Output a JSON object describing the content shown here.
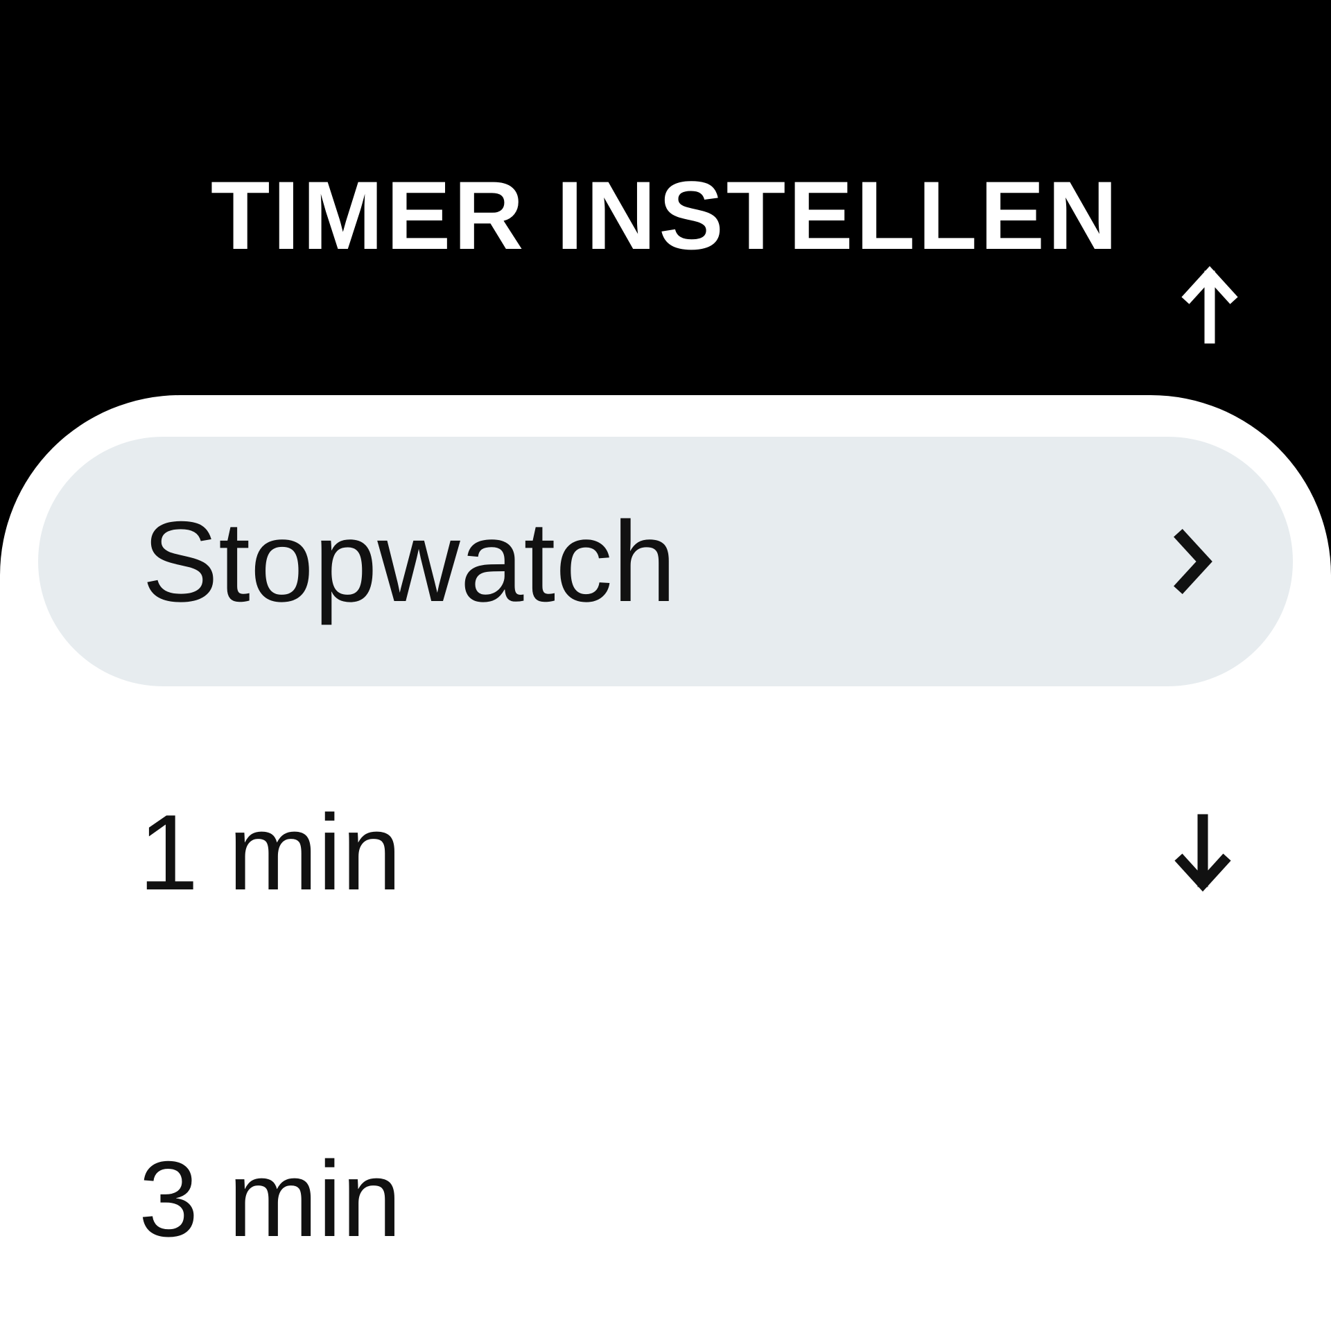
{
  "title": "TIMER INSTELLEN",
  "options": {
    "selected": {
      "label": "Stopwatch"
    },
    "row1": {
      "label": "1 min"
    },
    "row2": {
      "label": "3 min"
    }
  },
  "icons": {
    "scroll_up": "arrow-up-icon",
    "scroll_down": "arrow-down-icon",
    "chevron": "chevron-right-icon"
  }
}
